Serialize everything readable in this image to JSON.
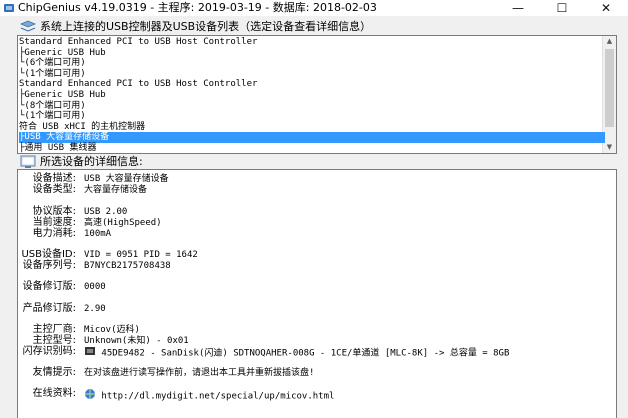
{
  "window": {
    "title": "ChipGenius v4.19.0319 - 主程序: 2019-03-19 - 数据库: 2018-02-03",
    "minimize_glyph": "—",
    "maximize_glyph": "☐",
    "close_glyph": "✕"
  },
  "device_list": {
    "label": "系统上连接的USB控制器及USB设备列表（选定设备查看详细信息）",
    "items": [
      "Standard Enhanced PCI to USB Host Controller",
      "├Generic USB Hub",
      "  └(6个端口可用)",
      "└(1个端口可用)",
      "Standard Enhanced PCI to USB Host Controller",
      "├Generic USB Hub",
      "  └(8个端口可用)",
      "└(1个端口可用)",
      "符合 USB xHCI 的主机控制器",
      "├USB 大容量存储设备",
      "├通用 USB 集线器"
    ],
    "selected_index": 9
  },
  "details": {
    "label": "所选设备的详细信息:",
    "rows": [
      {
        "label": "设备描述:",
        "value": "USB 大容量存储设备"
      },
      {
        "label": "设备类型:",
        "value": "大容量存储设备"
      },
      {
        "label": "协议版本:",
        "value": "USB 2.00"
      },
      {
        "label": "当前速度:",
        "value": "高速(HighSpeed)"
      },
      {
        "label": "电力消耗:",
        "value": "100mA"
      },
      {
        "label": "USB设备ID:",
        "value": "VID = 0951 PID = 1642"
      },
      {
        "label": "设备序列号:",
        "value": "B7NYCB2175708438"
      },
      {
        "label": "设备修订版:",
        "value": "0000"
      },
      {
        "label": "产品修订版:",
        "value": "2.90"
      },
      {
        "label": "主控厂商:",
        "value": "Micov(迈科)"
      },
      {
        "label": "主控型号:",
        "value": "Unknown(未知) - 0x01"
      },
      {
        "label": "闪存识别码:",
        "value": "45DE9482 - SanDisk(闪迪) SDTNOQAHER-008G - 1CE/单通道 [MLC-8K] -> 总容量 = 8GB"
      },
      {
        "label": "友情提示:",
        "value": "在对该盘进行读写操作前，请退出本工具并重新拔插该盘!"
      },
      {
        "label": "在线资料:",
        "value": "http://dl.mydigit.net/special/up/micov.html"
      }
    ]
  }
}
